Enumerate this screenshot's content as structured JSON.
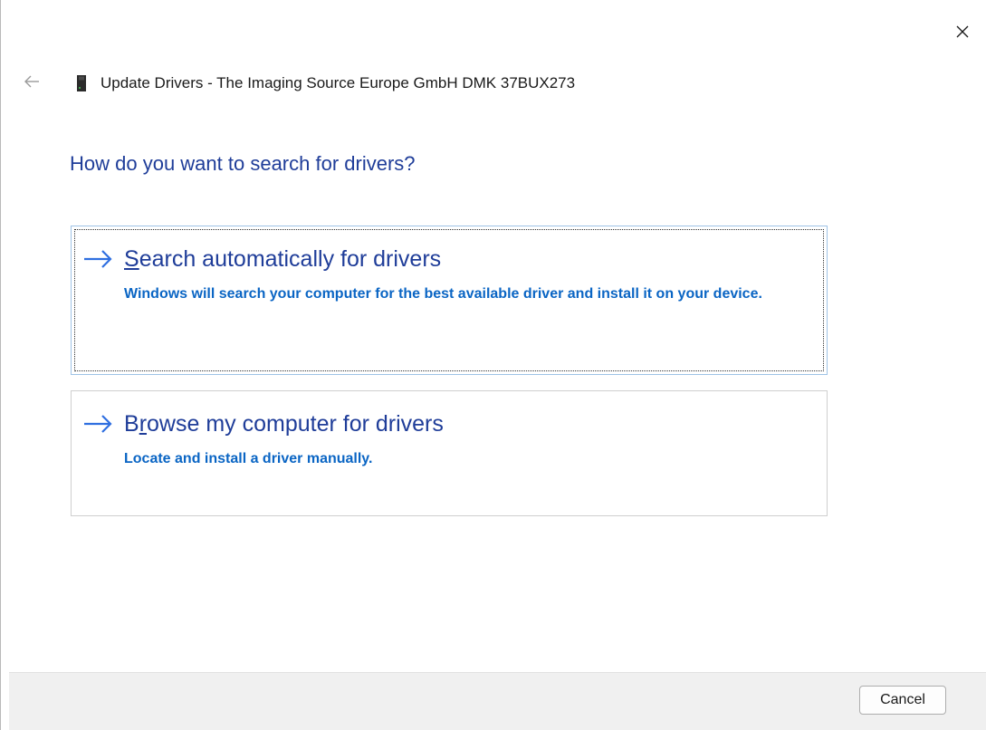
{
  "window": {
    "title": "Update Drivers - The Imaging Source Europe GmbH DMK 37BUX273"
  },
  "icons": {
    "back": "back-arrow-icon",
    "close": "close-icon",
    "device": "usb-device-icon",
    "option_arrow": "right-arrow-icon"
  },
  "colors": {
    "heading": "#1f3d99",
    "link_desc": "#0a65c4",
    "arrow": "#2f6fe0",
    "footer_bg": "#f0f0f0"
  },
  "main": {
    "heading": "How do you want to search for drivers?",
    "options": [
      {
        "title_first": "S",
        "title_rest": "earch automatically for drivers",
        "description": "Windows will search your computer for the best available driver and install it on your device."
      },
      {
        "title_first": "B",
        "title_mid": "r",
        "title_rest": "owse my computer for drivers",
        "description": "Locate and install a driver manually."
      }
    ]
  },
  "footer": {
    "cancel_label": "Cancel"
  }
}
